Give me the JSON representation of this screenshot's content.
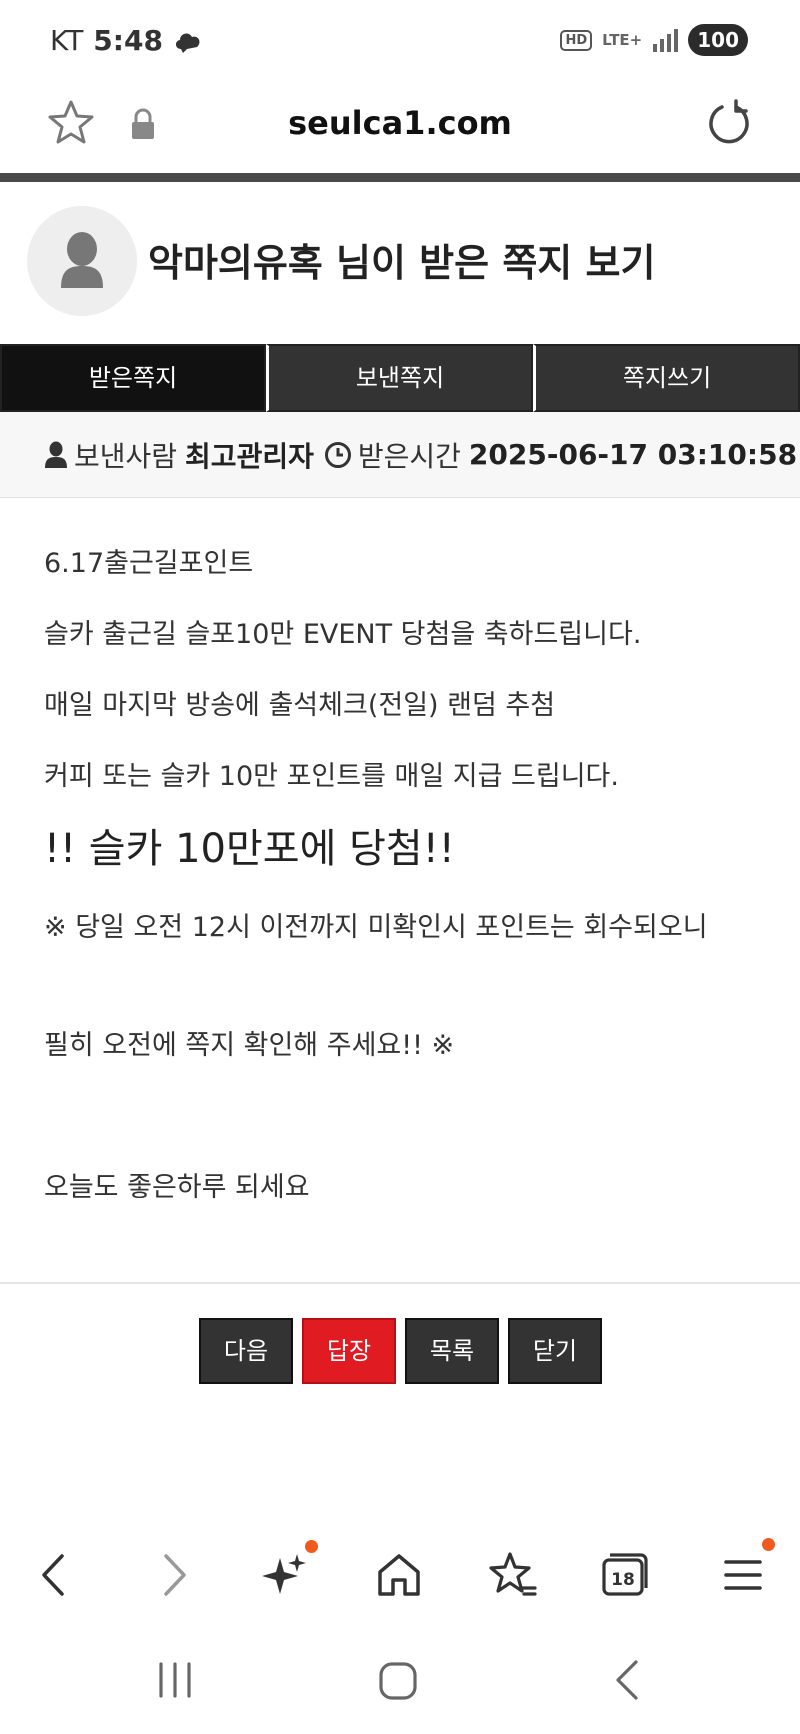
{
  "status_bar": {
    "carrier": "KT",
    "time": "5:48",
    "hd_label": "HD",
    "network": "LTE+",
    "battery": "100"
  },
  "address_bar": {
    "url": "seulca1.com"
  },
  "header": {
    "title": "악마의유혹 님이 받은 쪽지 보기"
  },
  "tabs": [
    {
      "label": "받은쪽지",
      "active": true
    },
    {
      "label": "보낸쪽지",
      "active": false
    },
    {
      "label": "쪽지쓰기",
      "active": false
    }
  ],
  "info": {
    "sender_label": "보낸사람",
    "sender_name": "최고관리자",
    "received_label": "받은시간",
    "received_time": "2025-06-17 03:10:58"
  },
  "message": {
    "lines": [
      "6.17출근길포인트",
      "슬카 출근길 슬포10만 EVENT 당첨을 축하드립니다.",
      "매일 마지막 방송에 출석체크(전일) 랜덤 추첨",
      "커피 또는 슬카 10만 포인트를 매일 지급 드립니다.",
      "!! 슬카 10만포에 당첨!!",
      "※ 당일 오전 12시 이전까지 미확인시 포인트는 회수되오니",
      "필히 오전에 쪽지 확인해 주세요!! ※",
      "오늘도 좋은하루 되세요"
    ]
  },
  "actions": {
    "next": "다음",
    "reply": "답장",
    "list": "목록",
    "close": "닫기"
  },
  "toolbar": {
    "tabs_count": "18"
  },
  "colors": {
    "accent_red": "#e01b22",
    "dark_button": "#333333",
    "notification_dot": "#f05a1e"
  }
}
